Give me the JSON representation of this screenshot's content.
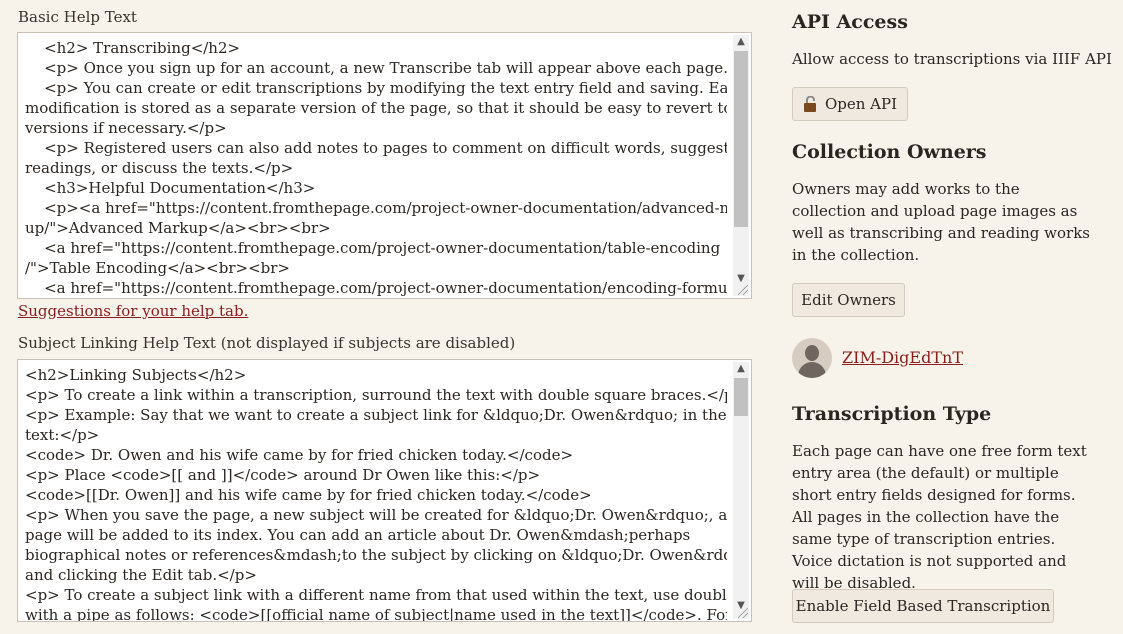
{
  "basic_help": {
    "label": "Basic Help Text",
    "lines": [
      "    <h2> Transcribing</h2>",
      "    <p> Once you sign up for an account, a new Transcribe tab will appear above each page.</p>",
      "    <p> You can create or edit transcriptions by modifying the text entry field and saving. Each",
      "modification is stored as a separate version of the page, so that it should be easy to revert to older",
      "versions if necessary.</p>",
      "    <p> Registered users can also add notes to pages to comment on difficult words, suggest",
      "readings, or discuss the texts.</p>",
      "    <h3>Helpful Documentation</h3>",
      "    <p><a href=\"https://content.fromthepage.com/project-owner-documentation/advanced-mark-",
      "up/\">Advanced Markup</a><br><br>",
      "    <a href=\"https://content.fromthepage.com/project-owner-documentation/table-encoding",
      "/\">Table Encoding</a><br><br>",
      "    <a href=\"https://content.fromthepage.com/project-owner-documentation/encoding-formula-"
    ],
    "suggestion_link": "Suggestions for your help tab."
  },
  "subject_help": {
    "label": "Subject Linking Help Text (not displayed if subjects are disabled)",
    "lines": [
      "<h2>Linking Subjects</h2>",
      "<p> To create a link within a transcription, surround the text with double square braces.</p>",
      "<p> Example: Say that we want to create a subject link for &ldquo;Dr. Owen&rdquo; in the",
      "text:</p>",
      "<code> Dr. Owen and his wife came by for fried chicken today.</code>",
      "<p> Place <code>[[ and ]]</code> around Dr Owen like this:</p>",
      "<code>[[Dr. Owen]] and his wife came by for fried chicken today.</code>",
      "<p> When you save the page, a new subject will be created for &ldquo;Dr. Owen&rdquo;, and the",
      "page will be added to its index. You can add an article about Dr. Owen&mdash;perhaps",
      "biographical notes or references&mdash;to the subject by clicking on &ldquo;Dr. Owen&rdquo;",
      "and clicking the Edit tab.</p>",
      "<p> To create a subject link with a different name from that used within the text, use double braces",
      "with a pipe as follows: <code>[[official name of subject|name used in the text]]</code>. For"
    ]
  },
  "api_access": {
    "title": "API Access",
    "description": "Allow access to transcriptions via IIIF API",
    "button": "Open API",
    "icon": "unlock-icon"
  },
  "collection_owners": {
    "title": "Collection Owners",
    "description": "Owners may add works to the collection and upload page images as well as transcribing and reading works in the collection.",
    "button": "Edit Owners",
    "owner_name": "ZIM-DigEdTnT"
  },
  "transcription_type": {
    "title": "Transcription Type",
    "description": "Each page can have one free form text entry area (the default) or multiple short entry fields designed for forms. All pages in the collection have the same type of transcription entries. Voice dictation is not supported and will be disabled.",
    "button": "Enable Field Based Transcription"
  },
  "colors": {
    "background": "#f8f3ea",
    "link": "#8a1c1c",
    "button_bg": "#efe9df"
  }
}
